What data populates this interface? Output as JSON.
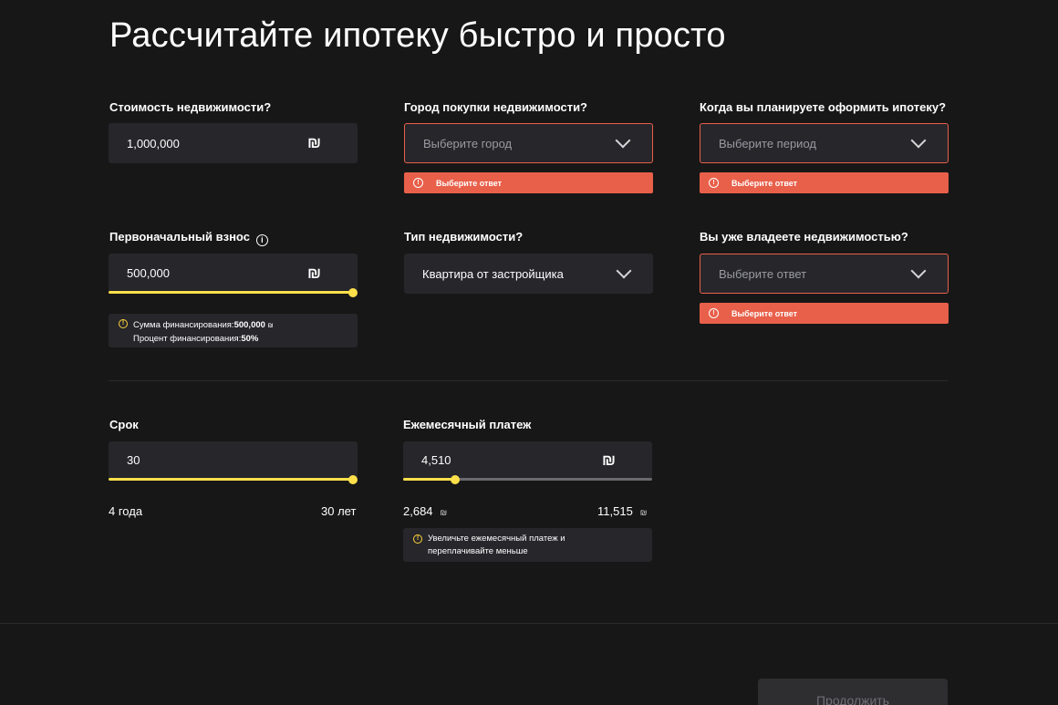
{
  "title": "Рассчитайте ипотеку быстро и просто",
  "currency_symbol": "₪",
  "fields": {
    "property_cost": {
      "label": "Стоимость недвижимости?",
      "value": "1,000,000"
    },
    "city": {
      "label": "Город покупки недвижимости?",
      "placeholder": "Выберите город",
      "error": "Выберите ответ"
    },
    "when": {
      "label": "Когда вы планируете оформить ипотеку?",
      "placeholder": "Выберите период",
      "error": "Выберите ответ"
    },
    "down_payment": {
      "label": "Первоначальный взнос",
      "value": "500,000",
      "slider_fraction": 1.0,
      "info_line1_label": "Сумма финансирования:",
      "info_line1_value": "500,000",
      "info_line1_currency": "₪",
      "info_line2_label": "Процент финансирования:",
      "info_line2_value": "50%"
    },
    "property_type": {
      "label": "Тип недвижимости?",
      "value": "Квартира от застройщика"
    },
    "own_property": {
      "label": "Вы уже владеете недвижимостью?",
      "placeholder": "Выберите ответ",
      "error": "Выберите ответ"
    },
    "term": {
      "label": "Срок",
      "value": "30",
      "slider_fraction": 1.0,
      "min_label": "4 года",
      "max_label": "30 лет"
    },
    "monthly": {
      "label": "Ежемесячный платеж",
      "value": "4,510",
      "slider_fraction": 0.21,
      "min_label": "2,684",
      "max_label": "11,515",
      "info_line1": "Увеличьте ежемесячный платеж и",
      "info_line2": "переплачивайте меньше"
    }
  },
  "continue_label": "Продолжить",
  "colors": {
    "accent": "#ffe04a",
    "error": "#e8604a",
    "bg": "#171717",
    "field_bg": "#26262b"
  }
}
